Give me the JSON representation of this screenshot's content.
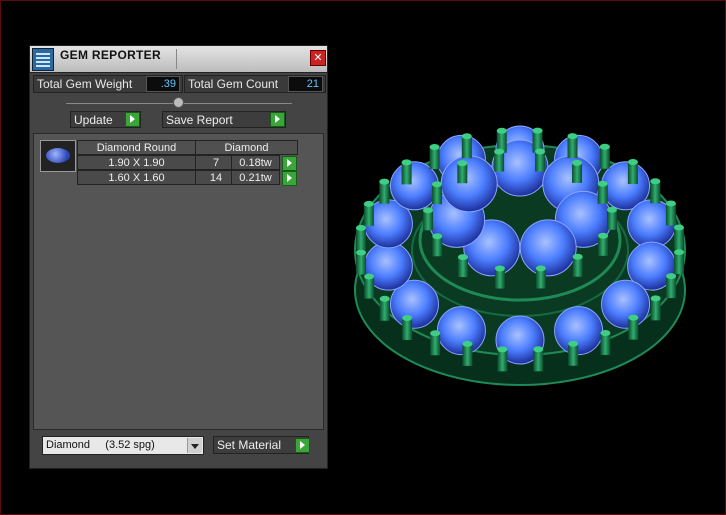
{
  "window": {
    "title": "GEM REPORTER",
    "close_glyph": "✕"
  },
  "summary": {
    "weight_label": "Total Gem Weight",
    "weight_value": ".39",
    "count_label": "Total Gem Count",
    "count_value": "21"
  },
  "toolbar": {
    "update_label": "Update",
    "save_label": "Save Report"
  },
  "gem_list": {
    "shape_header": "Diamond Round",
    "material_header": "Diamond",
    "rows": [
      {
        "size": "1.90 X 1.90",
        "count": "7",
        "weight": "0.18tw"
      },
      {
        "size": "1.60 X 1.60",
        "count": "14",
        "weight": "0.21tw"
      }
    ]
  },
  "material": {
    "selected": "Diamond     (3.52 spg)",
    "set_label": "Set Material"
  },
  "colors": {
    "panel_bg": "#444444",
    "value_text": "#5fc8ff",
    "go_button": "#3aa63a",
    "model_metal": "#1f8a55",
    "model_gem": "#4b7dff"
  }
}
